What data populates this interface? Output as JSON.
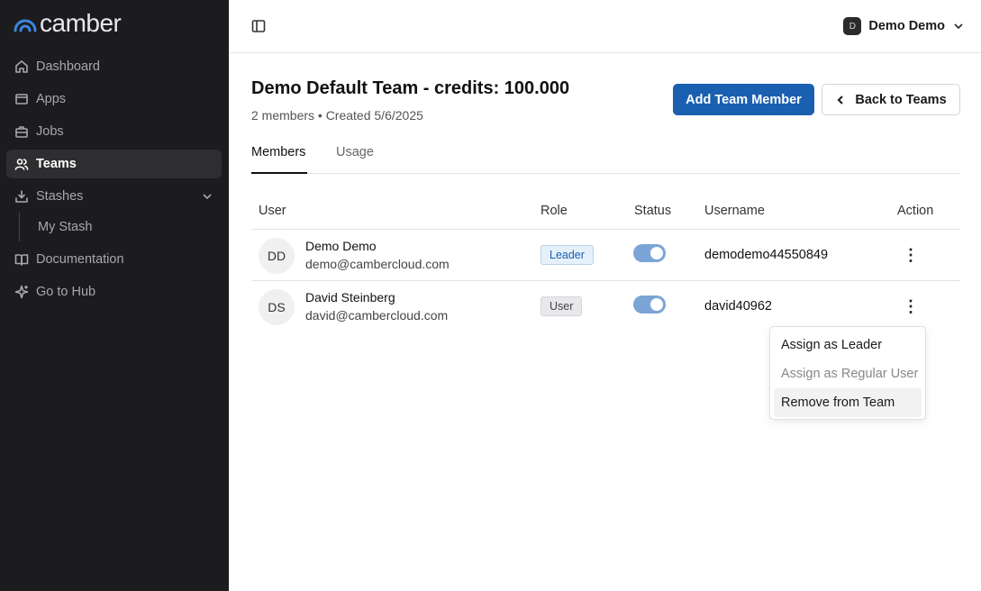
{
  "app": {
    "logo_text": "camber"
  },
  "sidebar": {
    "items": [
      {
        "label": "Dashboard",
        "icon": "home-icon"
      },
      {
        "label": "Apps",
        "icon": "window-icon"
      },
      {
        "label": "Jobs",
        "icon": "briefcase-icon"
      },
      {
        "label": "Teams",
        "icon": "users-icon",
        "active": true
      },
      {
        "label": "Stashes",
        "icon": "download-tray-icon",
        "expandable": true
      }
    ],
    "sub_items": [
      {
        "label": "My Stash"
      }
    ],
    "footer_items": [
      {
        "label": "Documentation",
        "icon": "book-icon"
      },
      {
        "label": "Go to Hub",
        "icon": "sparkle-icon"
      }
    ]
  },
  "topbar": {
    "user_initial": "D",
    "user_name": "Demo Demo"
  },
  "team": {
    "title": "Demo Default Team - credits: 100.000",
    "subtitle": "2 members • Created 5/6/2025",
    "add_button": "Add Team Member",
    "back_button": "Back to Teams"
  },
  "tabs": [
    {
      "label": "Members",
      "active": true
    },
    {
      "label": "Usage",
      "active": false
    }
  ],
  "table": {
    "headers": [
      "User",
      "Role",
      "Status",
      "Username",
      "Action"
    ],
    "rows": [
      {
        "initials": "DD",
        "name": "Demo Demo",
        "email": "demo@cambercloud.com",
        "role": "Leader",
        "status_on": true,
        "username": "demodemo44550849"
      },
      {
        "initials": "DS",
        "name": "David Steinberg",
        "email": "david@cambercloud.com",
        "role": "User",
        "status_on": true,
        "username": "david40962"
      }
    ]
  },
  "action_menu": {
    "items": [
      {
        "label": "Assign as Leader",
        "disabled": false
      },
      {
        "label": "Assign as Regular User",
        "disabled": true
      },
      {
        "label": "Remove from Team",
        "disabled": false,
        "hovered": true
      }
    ]
  },
  "colors": {
    "primary": "#1a5fb0",
    "sidebar_bg": "#1c1c1e",
    "toggle_on": "#7aa5d6"
  }
}
